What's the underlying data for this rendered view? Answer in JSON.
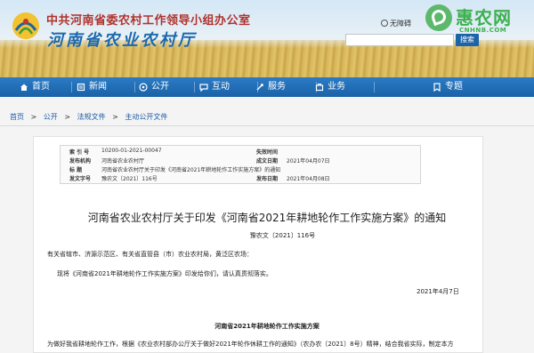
{
  "header": {
    "org_name": "中共河南省委农村工作领导小组办公室",
    "site_name": "河南省农业农村厅",
    "accessibility_label": "无障碍",
    "search_button_label": "搜索",
    "watermark_text": "惠农网",
    "watermark_url": "CNHNB.COM"
  },
  "nav": {
    "items": [
      {
        "label": "首页",
        "icon": "home-icon"
      },
      {
        "label": "新闻",
        "icon": "news-icon"
      },
      {
        "label": "公开",
        "icon": "open-icon"
      },
      {
        "label": "互动",
        "icon": "chat-icon"
      },
      {
        "label": "服务",
        "icon": "service-icon"
      },
      {
        "label": "业务",
        "icon": "business-icon"
      },
      {
        "label": "专题",
        "icon": "topic-icon"
      }
    ]
  },
  "breadcrumb": {
    "items": [
      "首页",
      ">",
      "公开",
      ">",
      "法规文件",
      ">",
      "主动公开文件"
    ]
  },
  "meta": {
    "row1": {
      "label": "索 引 号",
      "value": "10200-01-2021-00047",
      "rlabel": "失效时间",
      "rvalue": ""
    },
    "row2": {
      "label": "发布机构",
      "value": "河南省农业农村厅",
      "rlabel": "成文日期",
      "rvalue": "2021年04月07日"
    },
    "row3": {
      "label": "标    题",
      "value": "河南省农业农村厅关于印发《河南省2021年耕地轮作工作实施方案》的通知"
    },
    "row4": {
      "label": "发文字号",
      "value": "豫农文〔2021〕116号",
      "rlabel": "发布日期",
      "rvalue": "2021年04月08日"
    }
  },
  "document": {
    "title": "河南省农业农村厅关于印发《河南省2021年耕地轮作工作实施方案》的通知",
    "number": "豫农文〔2021〕116号",
    "recipients": "有关省辖市、济源示范区、有关省直管县（市）农业农村局，黄泛区农场：",
    "body": "现将《河南省2021年耕地轮作工作实施方案》印发给你们，请认真贯彻落实。",
    "date": "2021年4月7日",
    "attachment_title": "河南省2021年耕地轮作工作实施方案",
    "attachment_intro": "为做好我省耕地轮作工作，根据《农业农村部办公厅关于做好2021年轮作休耕工作的通知》（农办农〔2021〕8号）精神，结合我省实际，制定本方"
  },
  "colors": {
    "nav_bg": "#1a62a8",
    "title_blue": "#1b68ad",
    "title_red": "#b0322c",
    "link_blue": "#1c5aa6",
    "watermark_green": "#3eb050"
  }
}
